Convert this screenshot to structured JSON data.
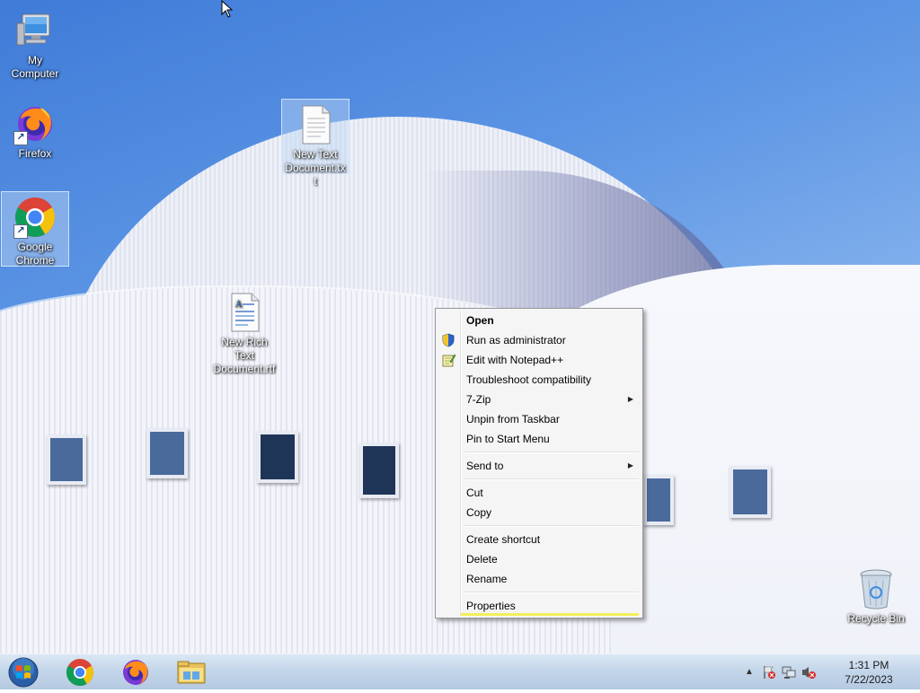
{
  "desktop": {
    "icons": [
      {
        "label": "My Computer",
        "icon": "computer-icon"
      },
      {
        "label": "Firefox",
        "icon": "firefox-icon"
      },
      {
        "label": "Google Chrome",
        "icon": "chrome-icon"
      },
      {
        "label": "New Text Document.txt",
        "icon": "text-document-icon"
      },
      {
        "label": "New Rich Text Document.rtf",
        "icon": "rich-text-document-icon"
      },
      {
        "label": "Recycle Bin",
        "icon": "recycle-bin-icon"
      }
    ]
  },
  "context_menu": {
    "items": [
      {
        "label": "Open",
        "bold": true
      },
      {
        "label": "Run as administrator",
        "icon": "uac-shield-icon"
      },
      {
        "label": "Edit with Notepad++",
        "icon": "notepad-plus-plus-icon"
      },
      {
        "label": "Troubleshoot compatibility"
      },
      {
        "label": "7-Zip",
        "submenu": true
      },
      {
        "label": "Unpin from Taskbar"
      },
      {
        "label": "Pin to Start Menu"
      },
      {
        "label": "Send to",
        "submenu": true
      },
      {
        "label": "Cut"
      },
      {
        "label": "Copy"
      },
      {
        "label": "Create shortcut"
      },
      {
        "label": "Delete"
      },
      {
        "label": "Rename"
      },
      {
        "label": "Properties"
      }
    ]
  },
  "taskbar": {
    "start_icon": "windows-orb-icon",
    "pinned": [
      "chrome-icon",
      "firefox-icon",
      "file-explorer-icon"
    ],
    "tray_icons": [
      "show-hidden-icons",
      "action-center-flag-icon",
      "network-icon",
      "volume-muted-icon"
    ],
    "clock_time": "1:31 PM",
    "clock_date": "7/22/2023"
  },
  "colors": {
    "sky": "#4a86dc",
    "menu_bg": "#f5f5f5",
    "menu_highlight": "#f3f05a",
    "taskbar": "#c4d6ea"
  }
}
